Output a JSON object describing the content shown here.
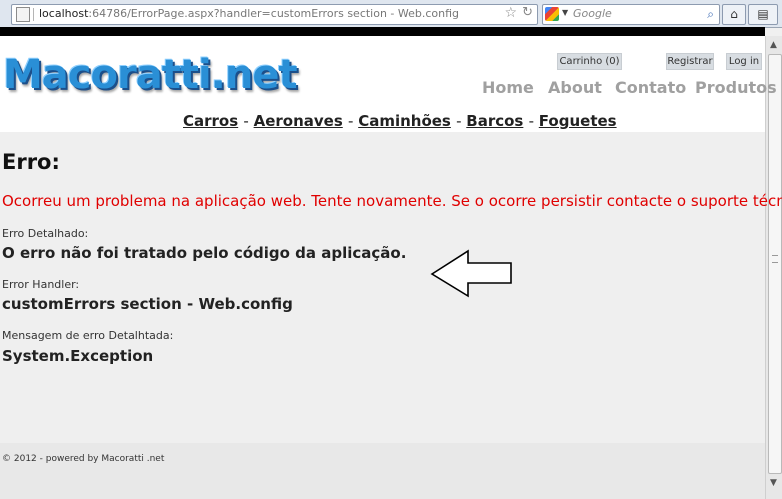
{
  "browser": {
    "url_host": "localhost",
    "url_rest": ":64786/ErrorPage.aspx?handler=customErrors section - Web.config",
    "search_placeholder": "Google"
  },
  "site": {
    "logo": "Macoratti.net",
    "cart": "Carrinho (0)",
    "register": "Registrar",
    "login": "Log in",
    "nav": [
      "Home",
      "About",
      "Contato",
      "Produtos"
    ],
    "categories": [
      "Carros",
      "Aeronaves",
      "Caminhões",
      "Barcos",
      "Foguetes"
    ]
  },
  "error": {
    "title": "Erro:",
    "message": "Ocorreu um problema na aplicação web. Tente novamente. Se o ocorre persistir contacte o suporte técnico.",
    "detail_label": "Erro Detalhado:",
    "detail_value": "O erro não foi tratado pelo código da aplicação.",
    "handler_label": "Error Handler:",
    "handler_value": "customErrors section - Web.config",
    "exception_label": "Mensagem de erro Detalhtada:",
    "exception_value": "System.Exception"
  },
  "footer": "© 2012 - powered by Macoratti .net"
}
